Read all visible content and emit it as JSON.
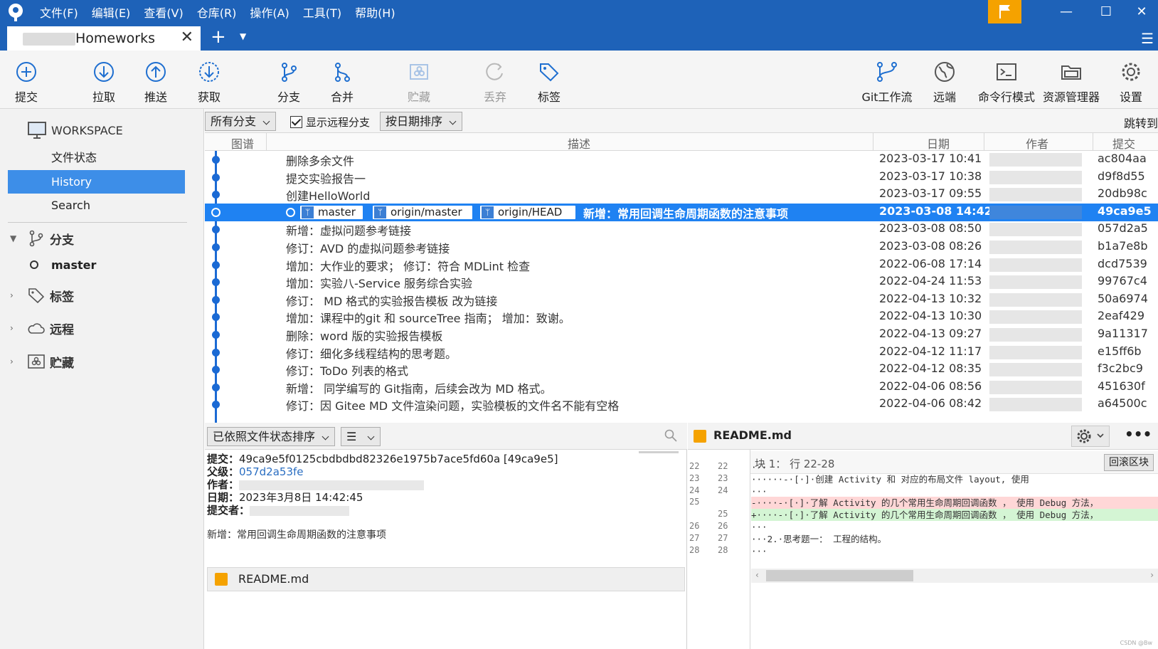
{
  "menu": [
    "文件(F)",
    "编辑(E)",
    "查看(V)",
    "仓库(R)",
    "操作(A)",
    "工具(T)",
    "帮助(H)"
  ],
  "window": {
    "minimize": "—",
    "maximize": "☐",
    "close": "✕"
  },
  "tab": {
    "title": "Homeworks",
    "close": "✕",
    "add": "+"
  },
  "toolbar": {
    "commit": "提交",
    "pull": "拉取",
    "push": "推送",
    "fetch": "获取",
    "branch": "分支",
    "merge": "合并",
    "stash": "贮藏",
    "discard": "丢弃",
    "tag": "标签",
    "gitflow": "Git工作流",
    "remote": "远端",
    "terminal": "命令行模式",
    "explorer": "资源管理器",
    "settings": "设置"
  },
  "sidebar": {
    "workspace": "WORKSPACE",
    "items": [
      "文件状态",
      "History",
      "Search"
    ],
    "branches": "分支",
    "branch_master": "master",
    "tags": "标签",
    "remotes": "远程",
    "stashes": "贮藏"
  },
  "filter": {
    "branches": "所有分支",
    "show_remote": "显示远程分支",
    "sort": "按日期排序",
    "jump": "跳转到"
  },
  "columns": {
    "graph": "图谱",
    "desc": "描述",
    "date": "日期",
    "author": "作者",
    "commit": "提交"
  },
  "commits": [
    {
      "desc": "删除多余文件",
      "date": "2023-03-17 10:41",
      "hash": "ac804aa"
    },
    {
      "desc": "提交实验报告一",
      "date": "2023-03-17 10:38",
      "hash": "d9f8d55"
    },
    {
      "desc": "创建HelloWorld",
      "date": "2023-03-17 09:55",
      "hash": "20db98c"
    },
    {
      "desc": "新增：常用回调生命周期函数的注意事项",
      "date": "2023-03-08 14:42",
      "hash": "49ca9e5"
    },
    {
      "desc": "新增：虚拟问题参考链接",
      "date": "2023-03-08 08:50",
      "hash": "057d2a5"
    },
    {
      "desc": "修订：AVD 的虚拟问题参考链接",
      "date": "2023-03-08 08:26",
      "hash": "b1a7e8b"
    },
    {
      "desc": "增加：大作业的要求； 修订：符合 MDLint 检查",
      "date": "2022-06-08 17:14",
      "hash": "dcd7539"
    },
    {
      "desc": "增加：实验八-Service 服务综合实验",
      "date": "2022-04-24 11:53",
      "hash": "99767c4"
    },
    {
      "desc": "修订： MD 格式的实验报告模板 改为链接",
      "date": "2022-04-13 10:32",
      "hash": "50a6974"
    },
    {
      "desc": "增加：课程中的git 和 sourceTree 指南； 增加：致谢。",
      "date": "2022-04-13 10:30",
      "hash": "2eaf429"
    },
    {
      "desc": "删除：word 版的实验报告模板",
      "date": "2022-04-13 09:27",
      "hash": "9a11317"
    },
    {
      "desc": "修订：细化多线程结构的思考题。",
      "date": "2022-04-12 11:17",
      "hash": "e15ff6b"
    },
    {
      "desc": "修订：ToDo 列表的格式",
      "date": "2022-04-12 08:35",
      "hash": "f3c2bc9"
    },
    {
      "desc": "新增：          同学编写的 Git指南，后续会改为 MD 格式。",
      "date": "2022-04-06 08:56",
      "hash": "451630f"
    },
    {
      "desc": "修订：因 Gitee MD 文件渲染问题，实验模板的文件名不能有空格",
      "date": "2022-04-06 08:42",
      "hash": "a64500c"
    }
  ],
  "refs": [
    "master",
    "origin/master",
    "origin/HEAD"
  ],
  "details": {
    "sort": "已依照文件状态排序",
    "commit_label": "提交：",
    "commit_value": "49ca9e5f0125cbdbdbd82326e1975b7ace5fd60a [49ca9e5]",
    "parent_label": "父级：",
    "parent_value": "057d2a53fe",
    "author_label": "作者：",
    "date_label": "日期：",
    "date_value": "2023年3月8日 14:42:45",
    "committer_label": "提交者：",
    "message": "新增：常用回调生命周期函数的注意事项",
    "file": "README.md"
  },
  "diff": {
    "file": "README.md",
    "hunk_label": "块 1： 行 22-28",
    "revert": "回滚区块",
    "left_lines": [
      "22",
      "23",
      "24",
      "25",
      "",
      "26",
      "27",
      "28"
    ],
    "right_lines": [
      "22",
      "23",
      "24",
      "",
      "25",
      "26",
      "27",
      "28"
    ],
    "lines": [
      {
        "type": "ctx",
        "text": "···"
      },
      {
        "type": "ctx",
        "text": "······-·[·]·创建 Activity 和 对应的布局文件 layout, 使用"
      },
      {
        "type": "ctx",
        "text": "···"
      },
      {
        "type": "del",
        "text": "-····-·[·]·了解 Activity 的几个常用生命周期回调函数 ， 使用 Debug 方法，"
      },
      {
        "type": "add",
        "text": "+····-·[·]·了解 Activity 的几个常用生命周期回调函数 ， 使用 Debug 方法，"
      },
      {
        "type": "ctx",
        "text": "···"
      },
      {
        "type": "ctx",
        "text": "···2.·思考题一：                  工程的结构。"
      },
      {
        "type": "ctx",
        "text": "···"
      }
    ]
  },
  "watermark": "CSDN @Bw"
}
